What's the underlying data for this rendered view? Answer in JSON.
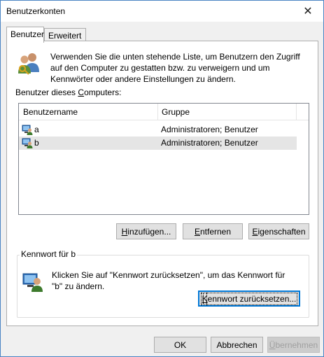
{
  "window": {
    "title": "Benutzerkonten",
    "close_glyph": "✕"
  },
  "tabs": [
    {
      "label": "Benutzer",
      "active": true
    },
    {
      "label": "Erweitert",
      "active": false
    }
  ],
  "intro": {
    "icon": "users-keys-icon",
    "text": "Verwenden Sie die unten stehende Liste, um Benutzern den Zugriff auf den Computer zu gestatten bzw. zu verweigern und um Kennwörter oder andere Einstellungen zu ändern."
  },
  "users_label": {
    "before": "Benutzer dieses ",
    "accel": "C",
    "after": "omputers:"
  },
  "table": {
    "columns": [
      "Benutzername",
      "Gruppe"
    ],
    "rows": [
      {
        "name": "a",
        "group": "Administratoren; Benutzer",
        "selected": false
      },
      {
        "name": "b",
        "group": "Administratoren; Benutzer",
        "selected": true
      }
    ]
  },
  "buttons": {
    "add": {
      "before": "",
      "accel": "H",
      "after": "inzufügen..."
    },
    "remove": {
      "before": "",
      "accel": "E",
      "after": "ntfernen"
    },
    "properties": {
      "before": "",
      "accel": "E",
      "after": "igenschaften"
    }
  },
  "password_group": {
    "title": "Kennwort für b",
    "text": "Klicken Sie auf \"Kennwort zurücksetzen\", um das Kennwort für \"b\" zu ändern.",
    "reset": {
      "before": "",
      "accel": "K",
      "after": "ennwort zurücksetzen..."
    }
  },
  "footer": {
    "ok": "OK",
    "cancel": "Abbrechen",
    "apply": {
      "before": "",
      "accel": "Ü",
      "after": "bernehmen"
    }
  },
  "colors": {
    "accent": "#0078d7",
    "window_bg": "#f0f0f0",
    "panel_bg": "#ffffff",
    "selection": "#e5e5e5"
  }
}
